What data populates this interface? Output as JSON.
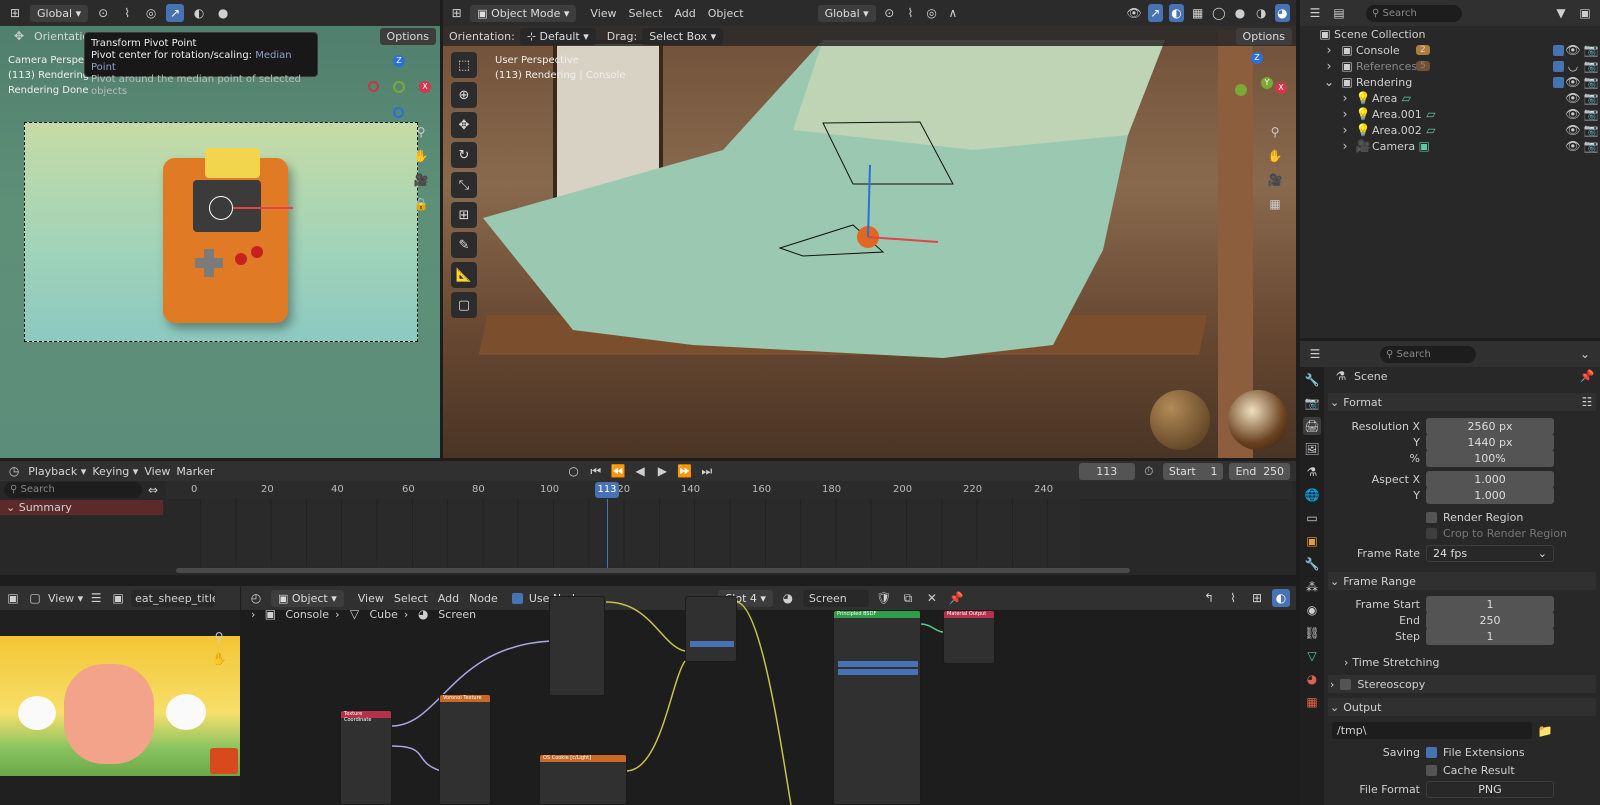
{
  "viewport_left": {
    "orientation_label": "Orientation",
    "global_label": "Global",
    "options_label": "Options",
    "overlay_lines": [
      "Camera Perspective",
      "(113) Rendering",
      "Rendering Done"
    ],
    "tooltip": {
      "title": "Transform Pivot Point",
      "line1_prefix": "Pivot center for rotation/scaling:",
      "line1_value": "Median Point",
      "line2": "Pivot around the median point of selected objects"
    }
  },
  "viewport_main": {
    "mode_label": "Object Mode",
    "menus": [
      "View",
      "Select",
      "Add",
      "Object"
    ],
    "global_label": "Global",
    "orientation_label": "Orientation:",
    "orientation_value": "Default",
    "drag_label": "Drag:",
    "drag_value": "Select Box",
    "options_label": "Options",
    "overlay_lines": [
      "User Perspective",
      "(113) Rendering | Console"
    ]
  },
  "outliner": {
    "search_placeholder": "Search",
    "root": "Scene Collection",
    "items": [
      {
        "label": "Console",
        "badge": "2"
      },
      {
        "label": "References",
        "badge": "5"
      },
      {
        "label": "Rendering",
        "badge": ""
      },
      {
        "label": "Area",
        "badge": ""
      },
      {
        "label": "Area.001",
        "badge": ""
      },
      {
        "label": "Area.002",
        "badge": ""
      },
      {
        "label": "Camera",
        "badge": ""
      }
    ]
  },
  "properties": {
    "search_placeholder": "Search",
    "scene_label": "Scene",
    "format_label": "Format",
    "resolution_x_label": "Resolution X",
    "resolution_x": "2560 px",
    "y_label": "Y",
    "resolution_y": "1440 px",
    "percent_label": "%",
    "percent": "100%",
    "aspect_x_label": "Aspect X",
    "aspect_x": "1.000",
    "aspect_y_label": "Y",
    "aspect_y": "1.000",
    "render_region": "Render Region",
    "crop_region": "Crop to Render Region",
    "frame_rate_label": "Frame Rate",
    "frame_rate": "24 fps",
    "frame_range_label": "Frame Range",
    "frame_start_label": "Frame Start",
    "frame_start": "1",
    "end_label": "End",
    "end": "250",
    "step_label": "Step",
    "step": "1",
    "time_stretching": "Time Stretching",
    "stereoscopy": "Stereoscopy",
    "output_label": "Output",
    "output_path": "/tmp\\",
    "saving_label": "Saving",
    "file_extensions": "File Extensions",
    "cache_result": "Cache Result",
    "file_format_label": "File Format",
    "file_format": "PNG"
  },
  "timeline": {
    "playback": "Playback",
    "keying": "Keying",
    "view": "View",
    "marker": "Marker",
    "current_frame": "113",
    "start_label": "Start",
    "start": "1",
    "end_label": "End",
    "end": "250",
    "search_placeholder": "Search",
    "summary": "Summary",
    "ruler": [
      "0",
      "20",
      "40",
      "60",
      "80",
      "100",
      "120",
      "140",
      "160",
      "180",
      "200",
      "220",
      "240"
    ],
    "playhead": "113"
  },
  "image_editor": {
    "view": "View",
    "image_name": "eat_sheep_title.jpg"
  },
  "node_editor": {
    "object_label": "Object",
    "menus": [
      "View",
      "Select",
      "Add",
      "Node"
    ],
    "use_nodes": "Use Nodes",
    "slot": "Slot 4",
    "material": "Screen",
    "breadcrumbs": [
      "Console",
      "Cube",
      "Screen"
    ],
    "nodes": {
      "texcoord": "Texture Coordinate",
      "voronoi": "Voronoi Texture",
      "osl": "OS Cookie [c/Light]",
      "principled": "Principled BSDF",
      "output": "Material Output"
    }
  },
  "colors": {
    "accent": "#4772b3",
    "panel": "#303030",
    "background": "#1d1d1d",
    "playhead": "#4772b3"
  }
}
